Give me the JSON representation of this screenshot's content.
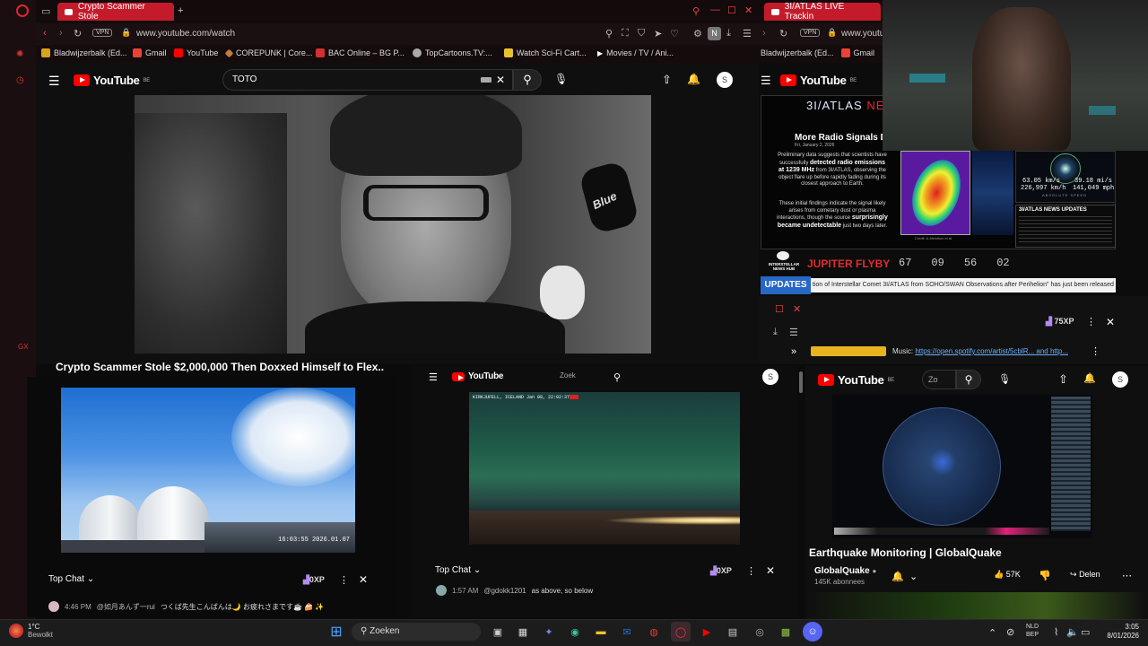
{
  "tabbar": {
    "active_tab": "Crypto Scammer Stole",
    "second_tab": "3I/ATLAS LIVE Trackin"
  },
  "address_bar": {
    "vpn": "VPN",
    "url": "www.youtube.com/watch",
    "url2": "www.youtu",
    "vpn2": "VPN",
    "profile_letter": "N"
  },
  "bookmarks": [
    {
      "label": "Bladwijzerbalk (Ed...",
      "color": "#d8a21e"
    },
    {
      "label": "Gmail",
      "color": "#ea4335"
    },
    {
      "label": "YouTube",
      "color": "#ff0000"
    },
    {
      "label": "COREPUNK | Core...",
      "color": "#c77a3a"
    },
    {
      "label": "BAC Online – BG P...",
      "color": "#d33030"
    },
    {
      "label": "TopCartoons.TV:...",
      "color": "#aaaaaa"
    },
    {
      "label": "Watch Sci-Fi Cart...",
      "color": "#e8c22c"
    },
    {
      "label": "Movies / TV / Ani...",
      "color": "#ffffff"
    }
  ],
  "bookmarks2": [
    {
      "label": "Bladwijzerbalk (Ed...",
      "color": "#d8a21e"
    },
    {
      "label": "Gmail",
      "color": "#ea4335"
    }
  ],
  "yt_main": {
    "logo": "YouTube",
    "region": "BE",
    "search_value": "TOTO",
    "avatar": "S",
    "video_title": "Crypto Scammer Stole $2,000,000 Then Doxxed Himself to Flex..",
    "mic_brand": "Blue"
  },
  "atlas": {
    "title": "3I/ATLAS",
    "title_suffix": "NE",
    "headline": "More Radio Signals D",
    "date": "Fri, January 2, 2026",
    "paragraph1_pre": "Preliminary data suggests that scientists have successfully ",
    "paragraph1_hl": "detected radio emissions at 1239 MHz",
    "paragraph1_post": " from 3I/ATLAS, observing the object flare up before rapidly fading during its closest approach to Earth.",
    "paragraph2_pre": "These initial findings indicate the signal likely arises from cometary dust or plasma interactions, though the source ",
    "paragraph2_hl": "surprisingly became undetectable",
    "paragraph2_post": " just two days later.",
    "speed_km": "63.05 km/s",
    "speed_mi": "39.18 mi/s",
    "speed_kmh": "226,997 km/h",
    "speed_mph": "141,049 mph",
    "speed_label": "ABSOLUTE SPEED",
    "news_label": "3I/ATLAS NEWS UPDATES",
    "hub": "INTERSTELLAR NEWS HUB",
    "flyby": "JUPITER FLYBY",
    "countdown": [
      "67",
      "09",
      "56",
      "02"
    ],
    "updates_label": "UPDATES",
    "ticker": "tion of Interstellar Comet 3I/ATLAS from SOHO/SWAN Observations after Perihelion\" has just been released",
    "credit": "Credit: A.Melnikov et al."
  },
  "right_chat": {
    "xp": "75XP",
    "music_label": "Music:",
    "music_link": "https://open.spotify.com/artist/5cblR... and http..."
  },
  "yt_quake": {
    "logo": "YouTube",
    "region": "BE",
    "search_short": "Zo",
    "avatar": "S",
    "title": "Earthquake Monitoring | GlobalQuake",
    "channel": "GlobalQuake",
    "subscribers": "145K abonnees",
    "likes": "57K",
    "share": "Delen"
  },
  "yt_center": {
    "logo": "YouTube",
    "search_short": "Zoek",
    "avatar": "S",
    "cam_stamp": "KIRKJUFELL, ICELAND  Jan 08, 22:02:37"
  },
  "chat_left": {
    "label": "Top Chat",
    "xp": "0XP",
    "time": "4:46 PM",
    "author": "@如月あんず一rui",
    "message": "つくば先生こんばんは🌙 お疲れさまです☕ 🍰 ✨",
    "cam_stamp": "16:03:55  2026.01.07"
  },
  "chat_center": {
    "label": "Top Chat",
    "xp": "0XP",
    "time": "1:57 AM",
    "author": "@gdokk1201",
    "message": "as above, so below"
  },
  "taskbar": {
    "temp": "1°C",
    "weather": "Bewolkt",
    "search": "Zoeken",
    "lang1": "NLD",
    "lang2": "BEP",
    "time": "3:05",
    "date": "8/01/2026"
  }
}
